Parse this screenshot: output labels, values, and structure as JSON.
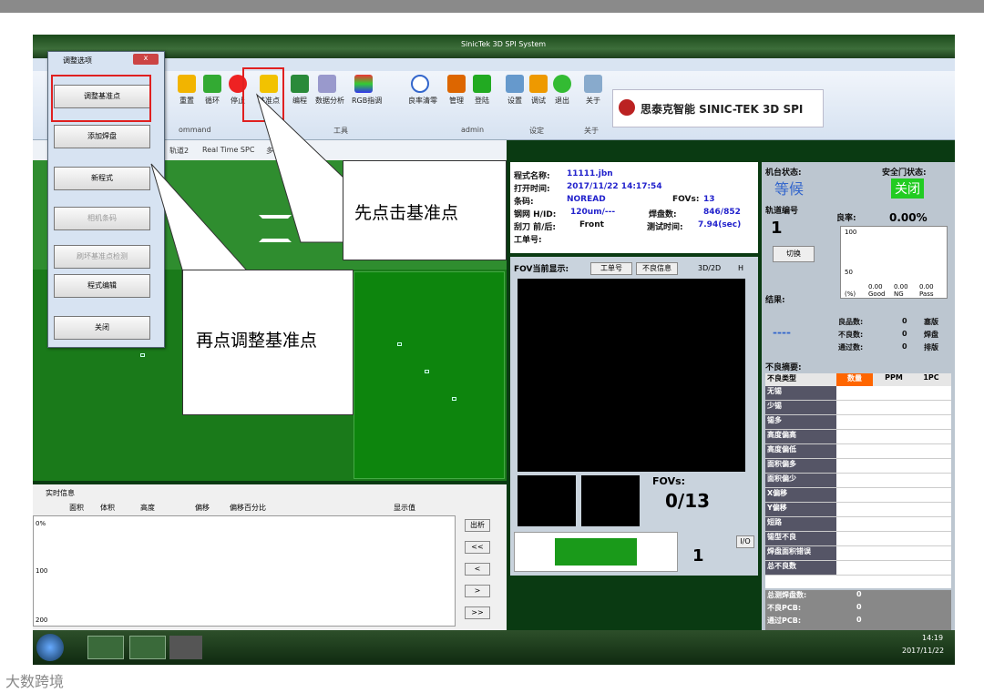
{
  "window": {
    "title": "SinicTek 3D SPI System"
  },
  "ribbon": {
    "buttons": [
      "重置",
      "循环",
      "停止",
      "基准点",
      "编程",
      "数据分析",
      "RGB指调",
      "良率清零",
      "管理",
      "登陆",
      "设置",
      "调试",
      "退出",
      "关于"
    ],
    "groups": [
      "ommand",
      "工具",
      "admin",
      "设定",
      "关于"
    ],
    "brand": "思泰克智能 SINIC-TEK 3D SPI"
  },
  "tabs": [
    "轨道2",
    "Real Time SPC",
    "多轨"
  ],
  "info": {
    "program_label": "程式名称:",
    "program_value": "11111.jbn",
    "open_label": "打开时间:",
    "open_value": "2017/11/22 14:17:54",
    "barcode_label": "条码:",
    "barcode_value": "NOREAD",
    "fovs_label": "FOVs:",
    "fovs_value": "13",
    "stencil_label": "钢网 H/ID:",
    "stencil_value": "120um/---",
    "pad_label": "焊盘数:",
    "pad_value": "846/852",
    "squeegee_label": "刮刀 前/后:",
    "squeegee_value": "Front",
    "test_time_label": "测试时间:",
    "test_time_value": "7.94(sec)",
    "order_label": "工单号:"
  },
  "fov": {
    "title": "FOV当前显示:",
    "btn_order": "工单号",
    "btn_bad": "不良信息",
    "chk_3d": "3D/2D",
    "chk_h": "H",
    "fovs_label": "FOVs:",
    "fovs_count": "0/13",
    "board_count": "1",
    "io": "I/O"
  },
  "status": {
    "machine_label": "机台状态:",
    "machine_value": "等候",
    "door_label": "安全门状态:",
    "door_value": "关闭",
    "track_label": "轨道编号",
    "track_value": "1",
    "switch": "切换",
    "yield_label": "良率:",
    "yield_value": "0.00%",
    "yield_axis": [
      "100",
      "50"
    ],
    "yield_vals": [
      "0.00",
      "0.00",
      "0.00"
    ],
    "yield_cols": [
      "(%)",
      "Good",
      "NG",
      "Pass"
    ],
    "result_label": "结果:",
    "result_value": "----",
    "good_label": "良品数:",
    "good_value": "0",
    "good_radio": "塞版",
    "bad_label": "不良数:",
    "bad_value": "0",
    "bad_radio": "焊盘",
    "pass_label": "通过数:",
    "pass_value": "0",
    "pass_radio": "排版",
    "defect_title": "不良摘要:",
    "defect_headers": [
      "不良类型",
      "数量",
      "PPM",
      "1PC"
    ],
    "defects": [
      "无锡",
      "少锡",
      "锡多",
      "高度偏高",
      "高度偏低",
      "面积偏多",
      "面积偏少",
      "X偏移",
      "Y偏移",
      "短路",
      "锡型不良",
      "焊盘面积错误",
      "总不良数"
    ],
    "totals": [
      {
        "label": "总测焊盘数:",
        "value": "0"
      },
      {
        "label": "不良PCB:",
        "value": "0"
      },
      {
        "label": "通过PCB:",
        "value": "0"
      }
    ]
  },
  "realtime": {
    "title": "实时信息",
    "options": [
      "面积",
      "体积",
      "高度",
      "偏移",
      "偏移百分比"
    ],
    "show_value": "显示值",
    "y_ticks": [
      "0%",
      "100",
      "200"
    ],
    "buttons": [
      "出析",
      "<<",
      "<",
      ">",
      ">>"
    ]
  },
  "dialog": {
    "title": "调整选项",
    "close": "x",
    "buttons": [
      "调整基准点",
      "添加焊盘",
      "新程式",
      "相机条码",
      "刷坏基准点检测",
      "程式编辑",
      "关闭"
    ]
  },
  "callouts": [
    "先点击基准点",
    "再点调整基准点"
  ],
  "clock": {
    "time": "14:19",
    "date": "2017/11/22"
  },
  "watermark": "大数跨境"
}
